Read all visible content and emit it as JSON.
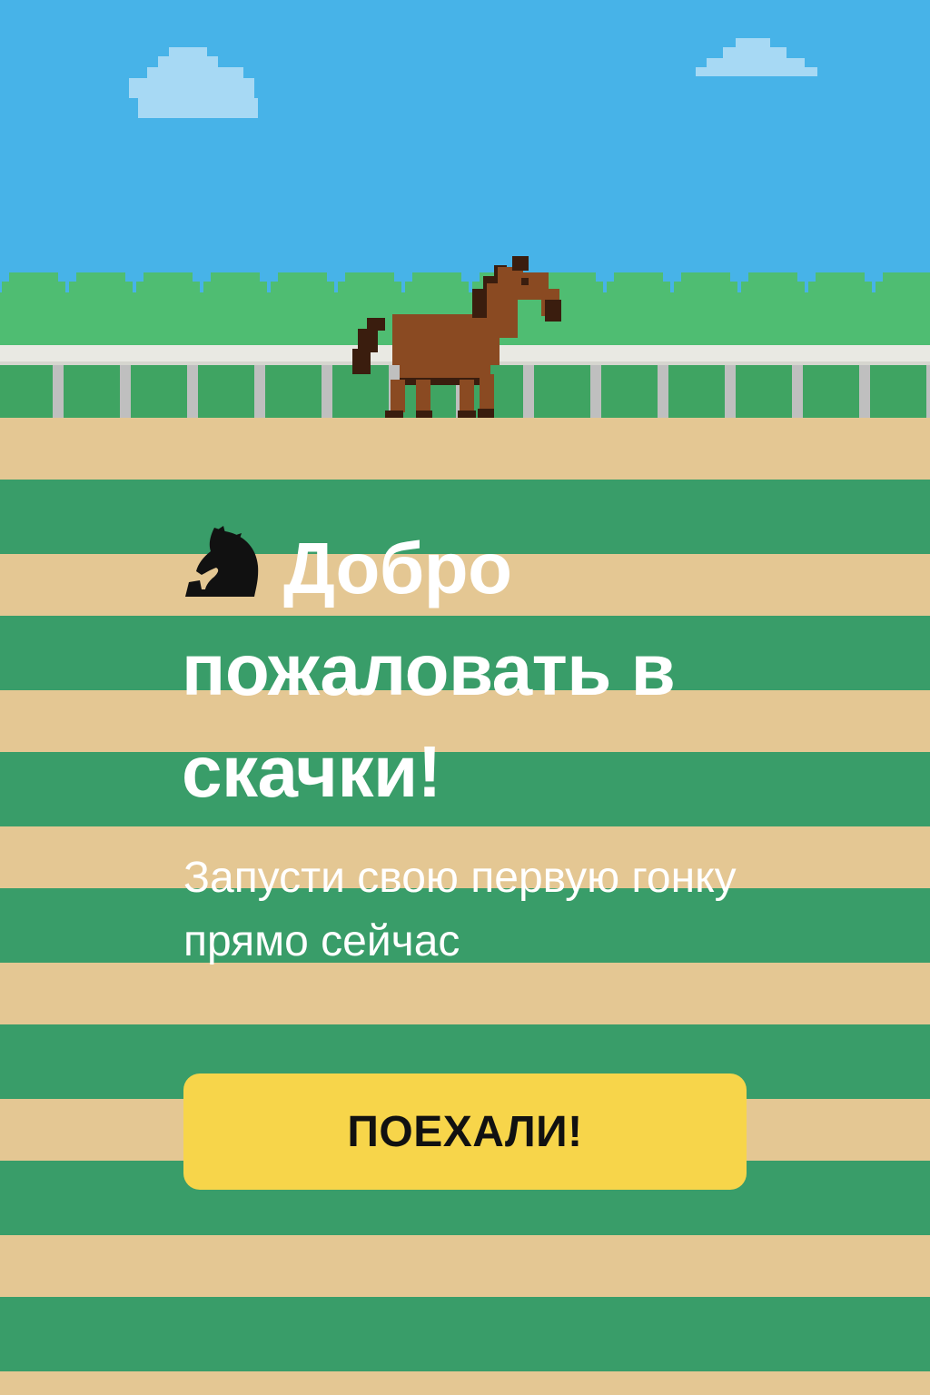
{
  "colors": {
    "sky": "#47b3e8",
    "cloud": "#a7d9f4",
    "hedge": "#4fbd72",
    "grass": "#3fa462",
    "fence": "#e9e9e3",
    "fence_post": "#bfbfbf",
    "dirt": "#e4c793",
    "track_green": "#399d69",
    "horse_body": "#8a4a22",
    "horse_dark": "#3a1d0e",
    "button": "#f7d54a",
    "button_text": "#111111",
    "text": "#ffffff"
  },
  "hero": {
    "icon": "chess-knight-icon",
    "title": "Добро пожаловать в скачки!",
    "subtitle": "Запусти свою первую гонку прямо сейчас"
  },
  "cta": {
    "label": "ПОЕХАЛИ!"
  }
}
